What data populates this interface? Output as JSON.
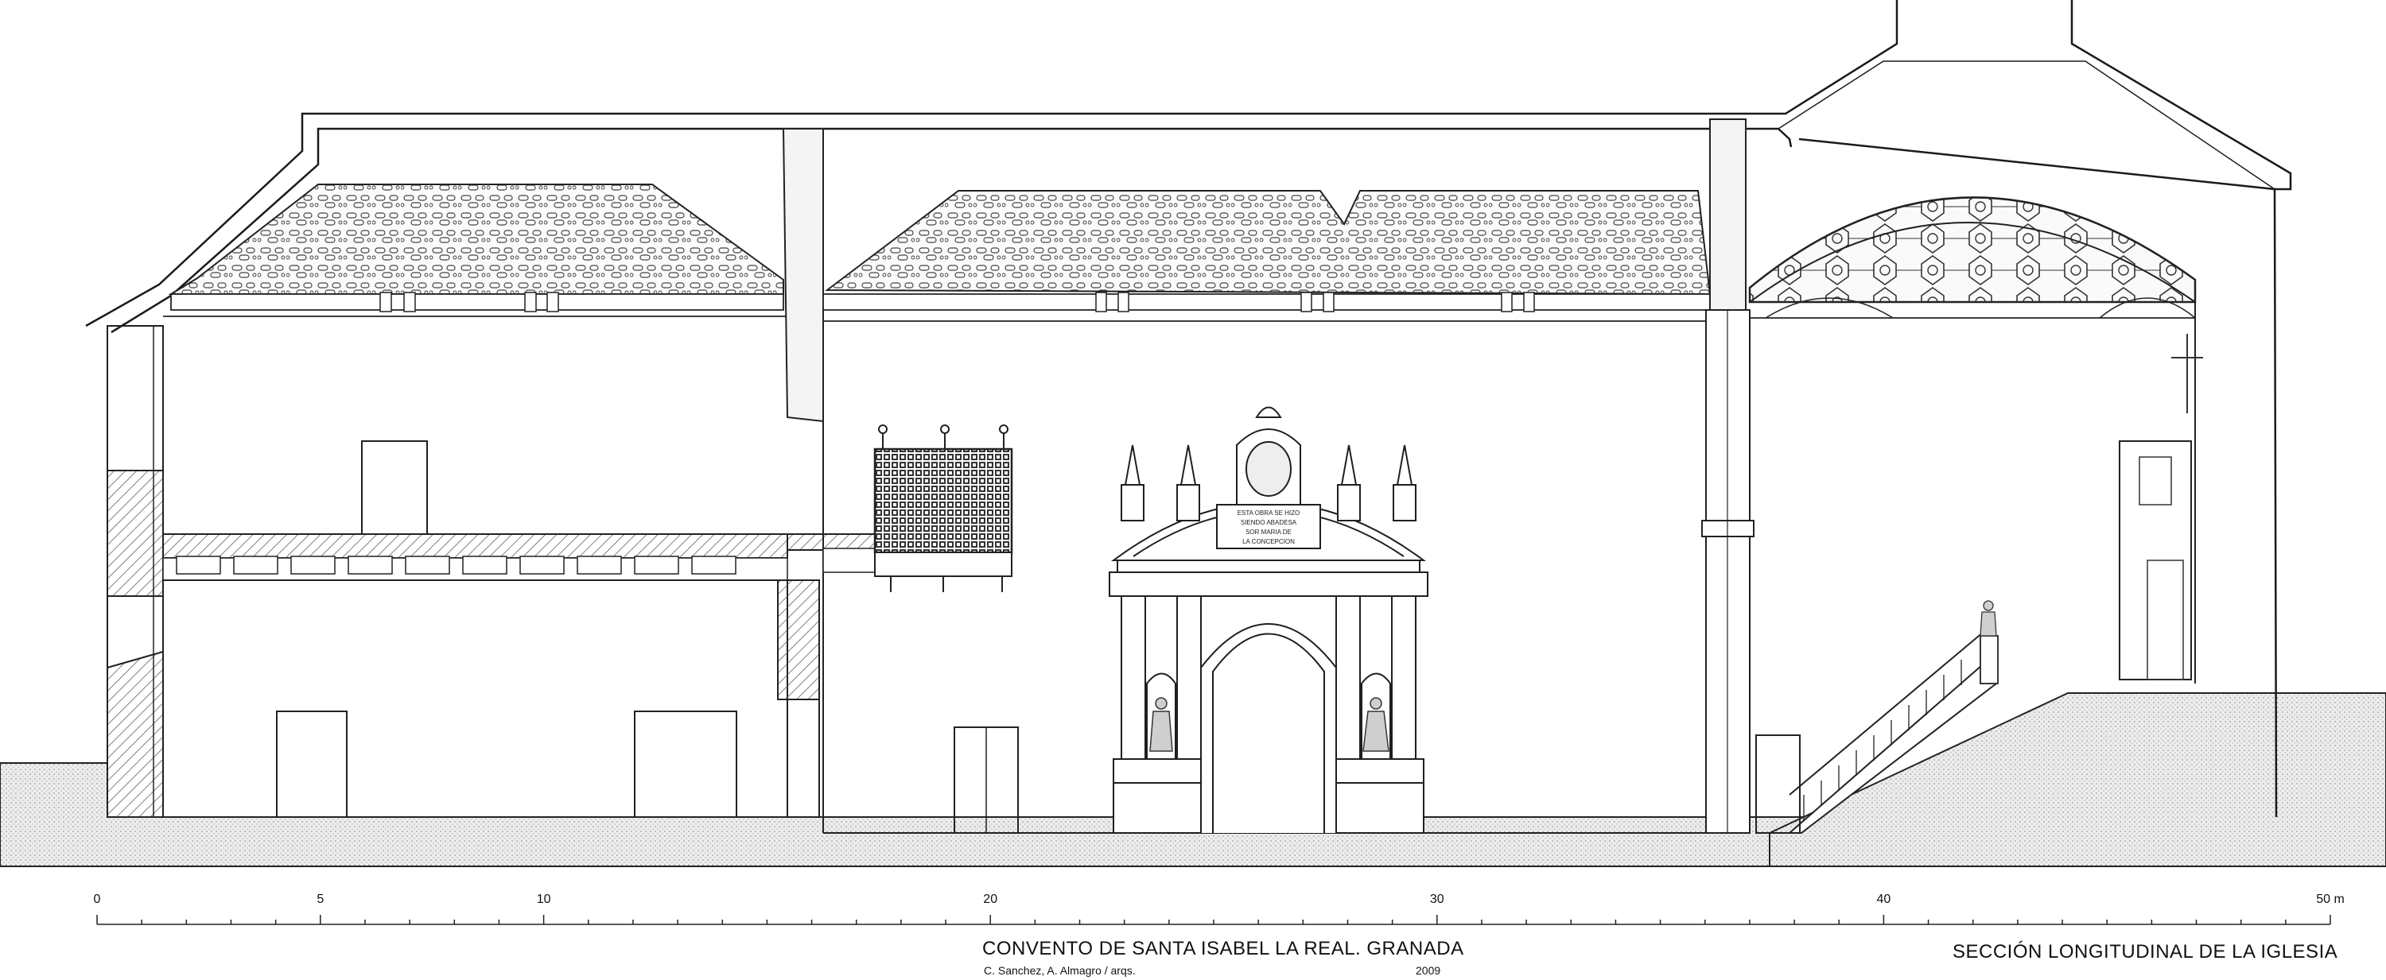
{
  "drawing": {
    "title": "CONVENTO DE SANTA ISABEL LA REAL. GRANADA",
    "authors": "C. Sanchez, A. Almagro / arqs.",
    "year": "2009",
    "section_title": "SECCIÓN LONGITUDINAL DE LA IGLESIA",
    "inscription_lines": [
      "ESTA OBRA SE HIZO",
      "SIENDO ABADESA",
      "SOR MARIA DE",
      "LA CONCEPCION"
    ],
    "colors": {
      "line": "#1a1a1a",
      "hatch": "#555555",
      "ground": "#e6e6e6"
    }
  },
  "scale_bar": {
    "unit": "m",
    "ticks": [
      {
        "value": 0,
        "label": "0"
      },
      {
        "value": 5,
        "label": "5"
      },
      {
        "value": 10,
        "label": "10"
      },
      {
        "value": 20,
        "label": "20"
      },
      {
        "value": 30,
        "label": "30"
      },
      {
        "value": 40,
        "label": "40"
      },
      {
        "value": 50,
        "label": "50 m"
      }
    ]
  }
}
